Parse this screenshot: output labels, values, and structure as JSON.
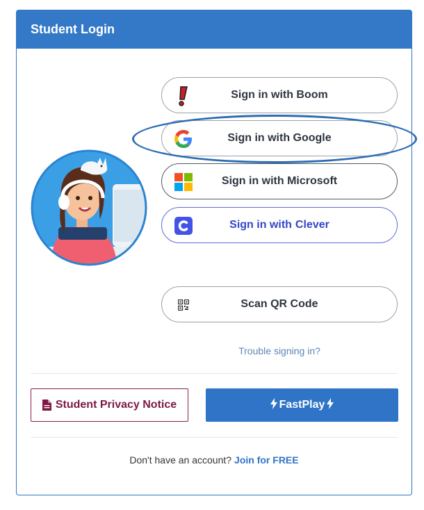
{
  "header": {
    "title": "Student Login"
  },
  "buttons": {
    "boom": "Sign in with Boom",
    "google": "Sign in with Google",
    "microsoft": "Sign in with Microsoft",
    "clever_prefix": "Sign in with",
    "clever_brand": "Clever",
    "qr": "Scan QR Code"
  },
  "trouble_link": "Trouble signing in?",
  "privacy_button": "Student Privacy Notice",
  "fastplay_button": "FastPlay",
  "signup": {
    "prompt": "Don't have an account?",
    "link": "Join for FREE"
  },
  "colors": {
    "header": "#3478c8",
    "primary": "#2f74c7",
    "privacy": "#7d1847",
    "clever": "#3346c8",
    "highlight": "#2c6db3"
  },
  "icons": [
    "boom-logo-icon",
    "google-logo-icon",
    "microsoft-logo-icon",
    "clever-logo-icon",
    "qr-code-icon",
    "document-icon",
    "lightning-bolt-icon"
  ]
}
